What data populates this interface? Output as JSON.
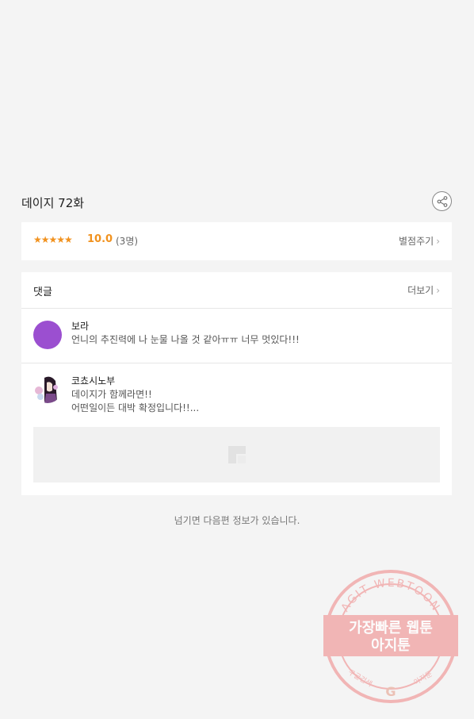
{
  "episode": {
    "title": "데이지 72화"
  },
  "rating": {
    "stars": "★★★★★",
    "score": "10.0",
    "count": "(3명)",
    "rate_label": "별점주기",
    "accent_color": "#f1921f"
  },
  "comments": {
    "header": "댓글",
    "more_label": "더보기",
    "items": [
      {
        "author": "보라",
        "text": "언니의 추진력에 나 눈물 나올 것 같아ㅠㅠ 너무 멋있다!!!"
      },
      {
        "author": "코쵸시노부",
        "line1": "데이지가 함께라면!!",
        "line2": "어떤일이든 대박 확정입니다!!..."
      }
    ]
  },
  "footer_note": "넘기면 다음편 정보가 있습니다.",
  "watermark": {
    "arc_text": "AGIT WEBTOON",
    "line1": "가장빠른 웹툰",
    "line2": "아지툰",
    "bottom_left": "구글검색",
    "bottom_right": "아지툰",
    "g_letter": "G",
    "color": "#f0a0a0"
  }
}
